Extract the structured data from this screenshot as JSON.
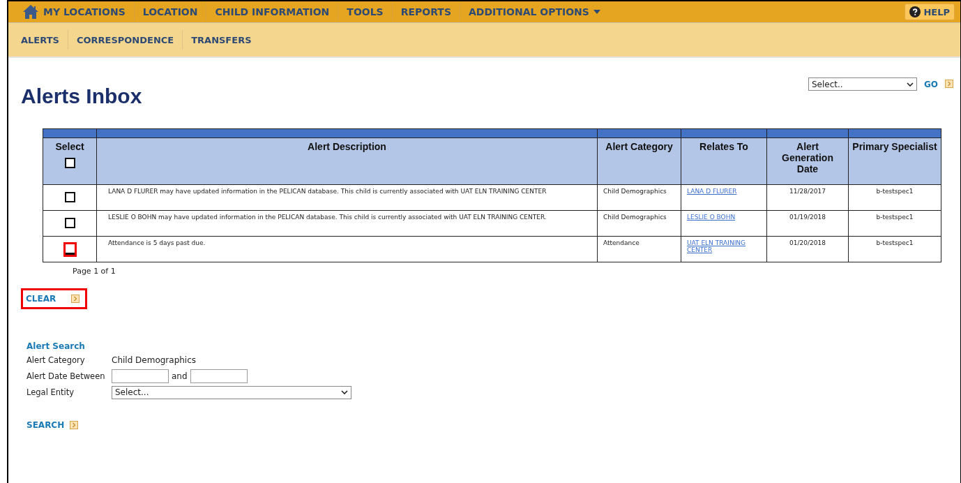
{
  "main_nav": {
    "items": [
      {
        "label": "MY LOCATIONS",
        "kind": "home"
      },
      {
        "label": "LOCATION",
        "kind": "plain"
      },
      {
        "label": "CHILD INFORMATION",
        "kind": "plain"
      },
      {
        "label": "TOOLS",
        "kind": "plain"
      },
      {
        "label": "REPORTS",
        "kind": "plain"
      },
      {
        "label": "ADDITIONAL OPTIONS",
        "kind": "dropdown"
      }
    ],
    "help": "HELP"
  },
  "sub_nav": {
    "items": [
      "ALERTS",
      "CORRESPONDENCE",
      "TRANSFERS"
    ]
  },
  "title": "Alerts Inbox",
  "action_select": {
    "placeholder": "Select..",
    "go": "GO"
  },
  "table": {
    "columns": [
      "Select",
      "Alert Description",
      "Alert Category",
      "Relates To",
      "Alert Generation Date",
      "Primary Specialist"
    ],
    "select_all_checked": false,
    "rows": [
      {
        "checked": false,
        "highlighted": false,
        "description": "LANA D FLURER may have updated information in the PELICAN database.  This child is currently associated with UAT ELN TRAINING CENTER",
        "category": "Child Demographics",
        "relates_to": "LANA D FLURER",
        "date": "11/28/2017",
        "specialist": "b-testspec1"
      },
      {
        "checked": false,
        "highlighted": false,
        "description": "LESLIE O BOHN may have updated information in the PELICAN database.  This child is currently associated with UAT ELN TRAINING CENTER.",
        "category": "Child Demographics",
        "relates_to": "LESLIE O BOHN",
        "date": "01/19/2018",
        "specialist": "b-testspec1"
      },
      {
        "checked": false,
        "highlighted": true,
        "description": "Attendance is 5 days past due.",
        "category": "Attendance",
        "relates_to": "UAT ELN TRAINING CENTER",
        "date": "01/20/2018",
        "specialist": "b-testspec1"
      }
    ],
    "pagination": "Page 1  of 1"
  },
  "clear_button": {
    "label": "CLEAR",
    "highlighted": true
  },
  "alert_search": {
    "title": "Alert Search",
    "category_label": "Alert Category",
    "category_value": "Child Demographics",
    "date_label": "Alert Date Between",
    "and_label": "and",
    "entity_label": "Legal Entity",
    "entity_placeholder": "Select...",
    "search": "SEARCH"
  }
}
